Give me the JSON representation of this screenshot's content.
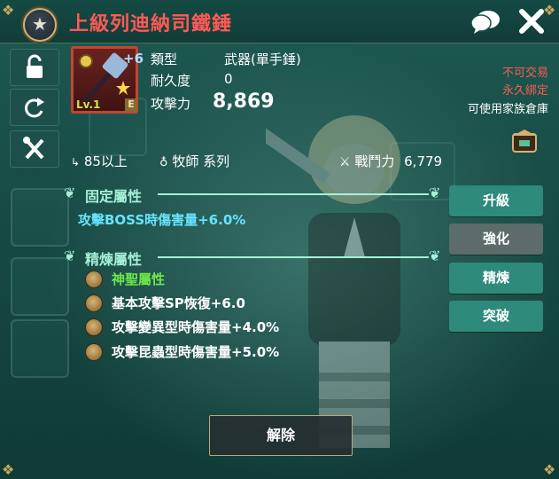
{
  "header": {
    "title": "上級列迪納司鐵錘"
  },
  "item": {
    "level_label": "Lv.1",
    "enhance_label": "+6",
    "grade_label": "E",
    "type_label": "類型",
    "type_value": "武器(單手錘)",
    "durability_label": "耐久度",
    "durability_value": "0",
    "attack_label": "攻擊力",
    "attack_value": "8,869",
    "untradable": "不可交易",
    "soulbound": "永久綁定",
    "guild_storage": "可使用家族倉庫"
  },
  "requirements": {
    "level": "85以上",
    "job": "牧師 系列",
    "power_label": "戰鬥力",
    "power_value": "6,779"
  },
  "fixed_section": {
    "title": "固定屬性",
    "attr": "攻擊BOSS時傷害量+6.0%"
  },
  "refine_section": {
    "title": "精煉屬性",
    "attrs": [
      {
        "text": "神聖屬性",
        "color": "#6ee84a"
      },
      {
        "text": "基本攻擊SP恢復+6.0",
        "color": "#ffffff"
      },
      {
        "text": "攻擊變異型時傷害量+4.0%",
        "color": "#ffffff"
      },
      {
        "text": "攻擊昆蟲型時傷害量+5.0%",
        "color": "#ffffff"
      }
    ]
  },
  "actions": {
    "upgrade": "升級",
    "enhance": "強化",
    "refine": "精煉",
    "breakthrough": "突破"
  },
  "footer": {
    "release": "解除"
  },
  "colors": {
    "title_red": "#ff5a57",
    "accent_teal": "#a7f0d6",
    "attr_cyan": "#66e4ff",
    "button_teal": "#2e8a7a",
    "button_gray": "#5b6c6a"
  }
}
